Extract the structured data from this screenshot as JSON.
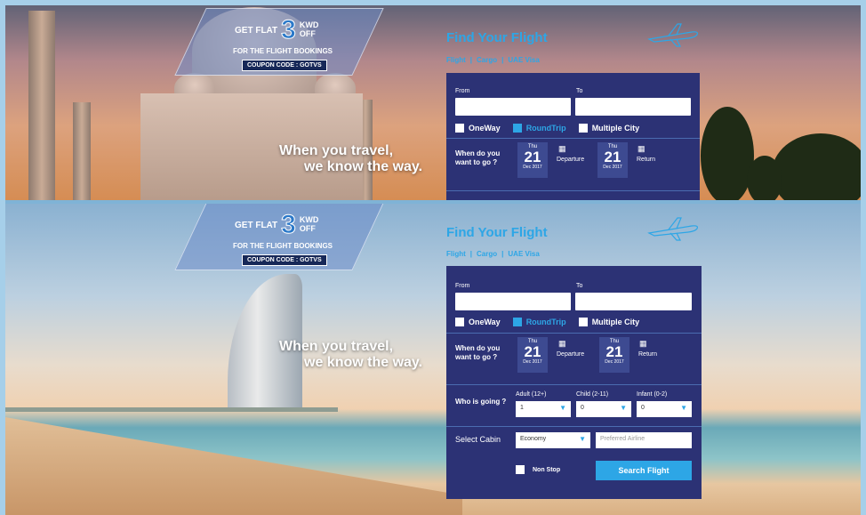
{
  "promo": {
    "prefix": "GET FLAT",
    "amount": "3",
    "currency": "KWD",
    "suffix": "OFF",
    "subtitle": "FOR THE FLIGHT BOOKINGS",
    "coupon_label": "COUPON CODE : GOTVS"
  },
  "tagline": {
    "line1": "When you travel,",
    "line2": "we know the way."
  },
  "search": {
    "title": "Find Your Flight",
    "links": [
      "Flight",
      "|",
      "Cargo",
      "|",
      "UAE Visa"
    ],
    "from_label": "From",
    "to_label": "To",
    "from_value": "",
    "to_value": "",
    "trip_types": [
      {
        "label": "OneWay",
        "selected": false
      },
      {
        "label": "RoundTrip",
        "selected": true
      },
      {
        "label": "Multiple City",
        "selected": false
      }
    ],
    "when_label": "When do you want to go ?",
    "departure": {
      "dow": "Thu",
      "day": "21",
      "monthyear": "Dec 2017",
      "label": "Departure"
    },
    "return": {
      "dow": "Thu",
      "day": "21",
      "monthyear": "Dec 2017",
      "label": "Return"
    },
    "who_label": "Who is going ?",
    "adult": {
      "label": "Adult (12+)",
      "value": "1"
    },
    "child": {
      "label": "Child (2-11)",
      "value": "0"
    },
    "infant": {
      "label": "Infant (0-2)",
      "value": "0"
    },
    "cabin_label": "Select Cabin",
    "cabin_value": "Economy",
    "airline_placeholder": "Preferred Airline",
    "nonstop_label": "Non Stop",
    "search_button": "Search Flight"
  },
  "colors": {
    "accent": "#2da6e6",
    "form_bg": "#2c3275",
    "coupon_bg": "#172858"
  },
  "icons": [
    "calendar-icon",
    "airplane-icon",
    "chevron-down-icon"
  ]
}
